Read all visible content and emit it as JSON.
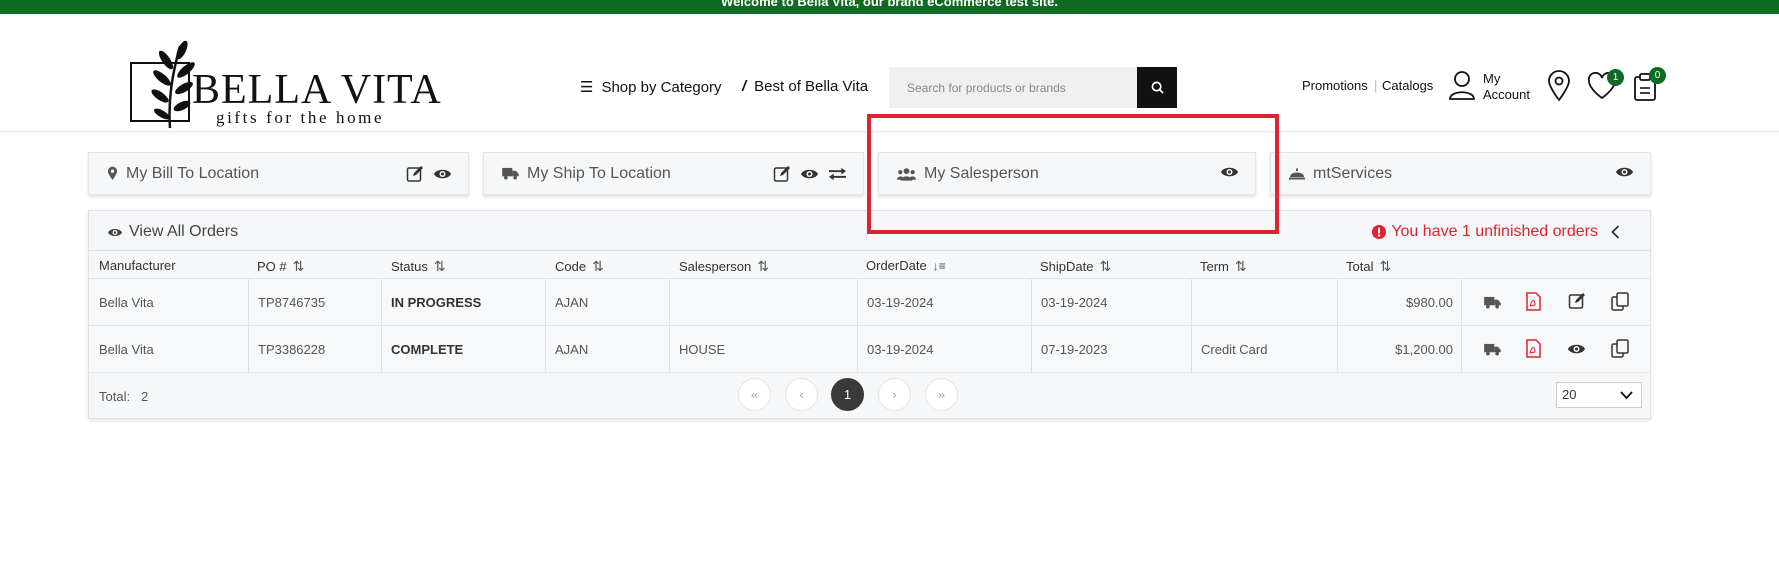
{
  "topbar": {
    "text": "Welcome to Bella Vita, our brand eCommerce test site."
  },
  "logo": {
    "name": "BELLA VITA",
    "tagline": "gifts for the home"
  },
  "nav": {
    "shop_by_category": "Shop by Category",
    "best_of": "Best of Bella Vita"
  },
  "search": {
    "placeholder": "Search for products or brands"
  },
  "header_links": {
    "promotions": "Promotions",
    "catalogs": "Catalogs",
    "my_account_line1": "My",
    "my_account_line2": "Account",
    "wishlist_count": "1",
    "cart_count": "0"
  },
  "cards": {
    "bill_to": "My Bill To Location",
    "ship_to": "My Ship To Location",
    "salesperson": "My Salesperson",
    "services": "mtServices"
  },
  "orders": {
    "view_all": "View All Orders",
    "unfinished": "You have 1 unfinished orders",
    "columns": [
      "Manufacturer",
      "PO #",
      "Status",
      "Code",
      "Salesperson",
      "OrderDate",
      "ShipDate",
      "Term",
      "Total"
    ],
    "rows": [
      {
        "manufacturer": "Bella Vita",
        "po": "TP8746735",
        "status": "IN PROGRESS",
        "code": "AJAN",
        "salesperson": "",
        "order_date": "03-19-2024",
        "ship_date": "03-19-2024",
        "term": "",
        "total": "$980.00"
      },
      {
        "manufacturer": "Bella Vita",
        "po": "TP3386228",
        "status": "COMPLETE",
        "code": "AJAN",
        "salesperson": "HOUSE",
        "order_date": "03-19-2024",
        "ship_date": "07-19-2023",
        "term": "Credit Card",
        "total": "$1,200.00"
      }
    ],
    "total_label": "Total:",
    "total_value": "2",
    "pagination": {
      "first": "«",
      "prev": "‹",
      "current": "1",
      "next": "›",
      "last": "»"
    },
    "page_size": "20"
  },
  "colors": {
    "brand_green": "#0d6b22",
    "alert_red": "#e0232e",
    "highlight_red": "#e0232e"
  }
}
